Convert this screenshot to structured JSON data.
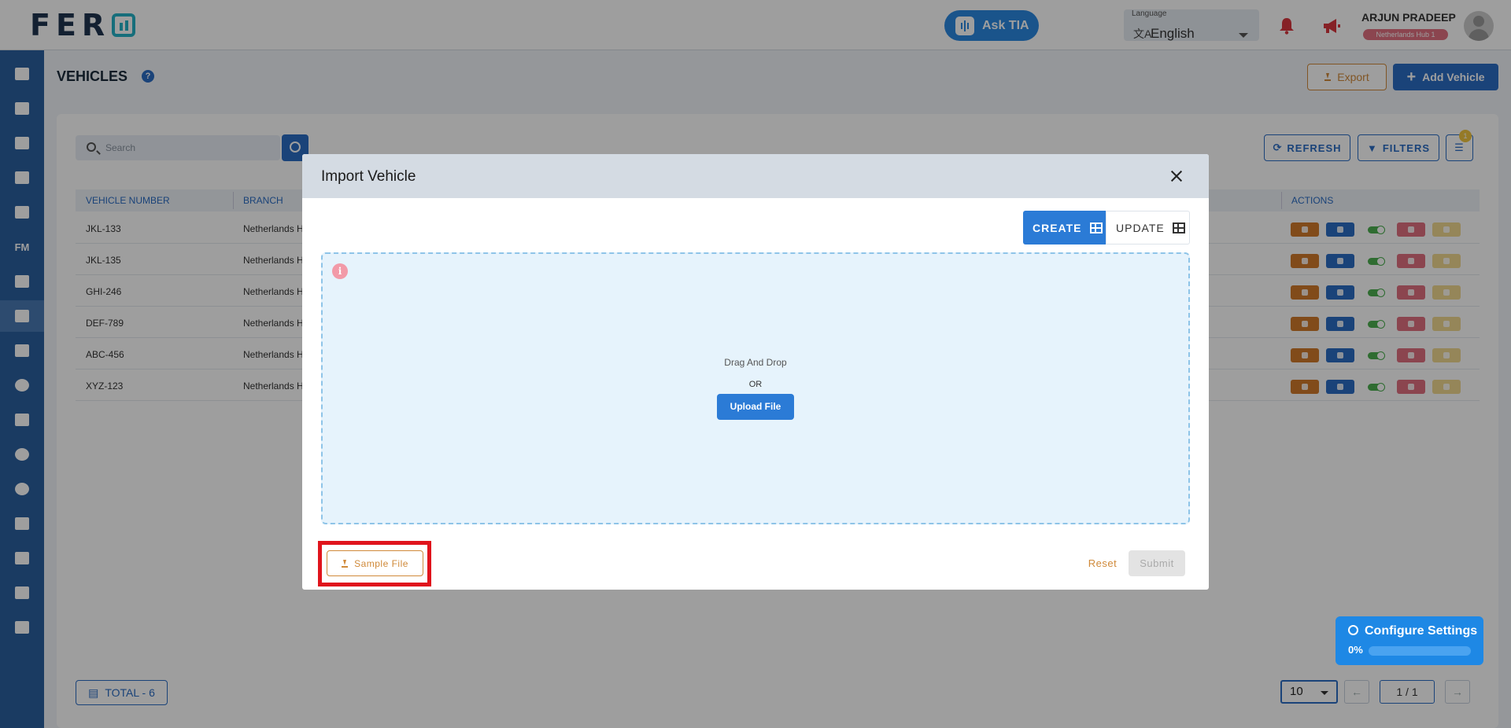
{
  "app": {
    "logo_text": "FER"
  },
  "header": {
    "ask_tia_label": "Ask TIA",
    "language_label": "Language",
    "language_value": "English",
    "user_name": "ARJUN PRADEEP",
    "user_hub": "Netherlands Hub 1"
  },
  "sidebar": {
    "items": [
      {
        "icon": "dashboard-icon"
      },
      {
        "icon": "analytics-icon"
      },
      {
        "icon": "calendar-icon"
      },
      {
        "icon": "truck-icon"
      },
      {
        "icon": "archive-icon"
      },
      {
        "label": "FM"
      },
      {
        "icon": "driver-icon"
      },
      {
        "icon": "vehicle-icon",
        "active": true
      },
      {
        "icon": "users-icon"
      },
      {
        "icon": "info-icon"
      },
      {
        "icon": "group-icon"
      },
      {
        "icon": "palette-icon"
      },
      {
        "icon": "settings-icon"
      },
      {
        "icon": "edit-note-icon"
      },
      {
        "icon": "clipboard-icon"
      },
      {
        "icon": "account-icon"
      },
      {
        "icon": "download-icon"
      }
    ]
  },
  "page": {
    "title": "VEHICLES",
    "export_label": "Export",
    "add_label": "Add Vehicle",
    "search_placeholder": "Search",
    "refresh_label": "REFRESH",
    "filters_label": "FILTERS",
    "column_badge": "1"
  },
  "table": {
    "headers": [
      "VEHICLE NUMBER",
      "BRANCH",
      "ACTIONS"
    ],
    "rows": [
      {
        "vehicle": "JKL-133",
        "branch": "Netherlands H"
      },
      {
        "vehicle": "JKL-135",
        "branch": "Netherlands H"
      },
      {
        "vehicle": "GHI-246",
        "branch": "Netherlands H"
      },
      {
        "vehicle": "DEF-789",
        "branch": "Netherlands H"
      },
      {
        "vehicle": "ABC-456",
        "branch": "Netherlands H"
      },
      {
        "vehicle": "XYZ-123",
        "branch": "Netherlands H"
      }
    ]
  },
  "footer": {
    "total_label": "TOTAL - 6",
    "page_size": "10",
    "page_info": "1 / 1"
  },
  "config": {
    "title": "Configure Settings",
    "percent": "0%",
    "progress": 0
  },
  "modal": {
    "title": "Import Vehicle",
    "create_label": "CREATE",
    "update_label": "UPDATE",
    "drag_text": "Drag And Drop",
    "or_text": "OR",
    "upload_label": "Upload File",
    "sample_label": "Sample File",
    "reset_label": "Reset",
    "submit_label": "Submit"
  },
  "colors": {
    "primary": "#2b6cc4",
    "accent_orange": "#d08a3a",
    "highlight_red": "#e0141c",
    "sidebar": "#2b5f9e"
  }
}
